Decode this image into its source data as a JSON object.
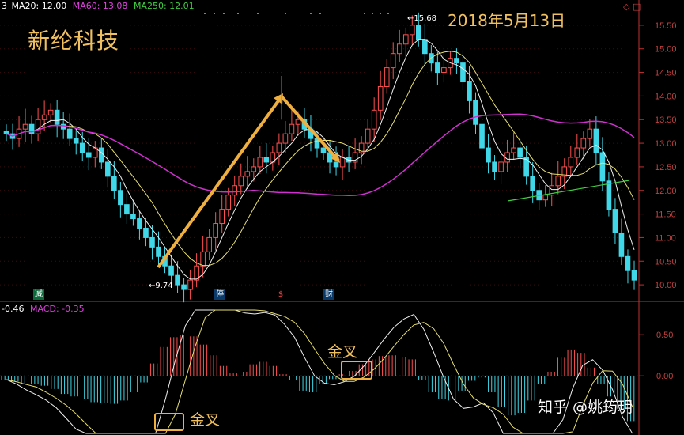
{
  "header": {
    "items": [
      {
        "text": "3",
        "color": "#ffffff"
      },
      {
        "text": "MA20: 12.00",
        "color": "#ffffff"
      },
      {
        "text": "MA60: 13.08",
        "color": "#e040e0"
      },
      {
        "text": "MA250: 12.01",
        "color": "#40d040"
      }
    ],
    "macd_items": [
      {
        "text": "-0.46",
        "color": "#ffffff"
      },
      {
        "text": "MACD: -0.35",
        "color": "#e040e0"
      }
    ]
  },
  "stock_name": "新纶科技",
  "date_label": "2018年5月13日",
  "annotations": {
    "low_label": "9.74",
    "high_label": "15.68",
    "golden_cross_1": "金叉",
    "golden_cross_2": "金叉"
  },
  "event_markers": [
    {
      "text": "减",
      "bg": "#0a6a3a",
      "color": "#ffffff"
    },
    {
      "text": "停",
      "bg": "#0a3a6a",
      "color": "#ffffff"
    },
    {
      "text": "$",
      "bg": "#000000",
      "color": "#ff4040"
    },
    {
      "text": "财",
      "bg": "#0a3a6a",
      "color": "#ffffff"
    }
  ],
  "watermark": "知乎 @姚筠玥",
  "colors": {
    "up": "#ff5050",
    "down": "#40d8e8",
    "ma_white": "#f0f0f0",
    "ma_yellow": "#e8e070",
    "ma_magenta": "#d030d0",
    "ma_green": "#40d040",
    "arrow": "#f0b040",
    "axis": "#c03030",
    "axis_text": "#c04040",
    "label_orange": "#f0c060"
  },
  "chart_data": [
    {
      "type": "candlestick",
      "title": "新纶科技",
      "ylim": [
        9.7,
        15.8
      ],
      "y_ticks": [
        "10.00",
        "10.50",
        "11.00",
        "11.50",
        "12.00",
        "12.50",
        "13.00",
        "13.50",
        "14.00",
        "14.50",
        "15.00",
        "15.50"
      ],
      "close": [
        13.2,
        13.1,
        13.3,
        13.4,
        13.2,
        13.5,
        13.6,
        13.7,
        13.4,
        13.3,
        13.1,
        13.0,
        12.8,
        12.7,
        12.9,
        12.6,
        12.3,
        12.0,
        11.7,
        11.5,
        11.4,
        11.2,
        11.0,
        10.8,
        10.6,
        10.4,
        10.2,
        10.0,
        9.9,
        10.1,
        10.4,
        10.7,
        11.0,
        11.3,
        11.6,
        11.9,
        12.1,
        12.3,
        12.4,
        12.5,
        12.7,
        12.6,
        12.8,
        13.0,
        13.2,
        13.4,
        13.5,
        13.3,
        13.1,
        12.9,
        12.8,
        12.6,
        12.5,
        12.7,
        12.6,
        12.8,
        13.0,
        13.3,
        13.7,
        14.2,
        14.6,
        14.9,
        15.1,
        15.3,
        15.5,
        15.2,
        14.9,
        14.7,
        14.5,
        14.6,
        14.8,
        14.7,
        14.3,
        13.9,
        13.4,
        12.9,
        12.6,
        12.4,
        12.6,
        12.8,
        12.9,
        12.7,
        12.3,
        12.0,
        11.8,
        11.9,
        12.1,
        12.3,
        12.5,
        12.7,
        12.9,
        13.1,
        13.3,
        12.8,
        12.2,
        11.6,
        11.1,
        10.6,
        10.3,
        10.1
      ],
      "macd_histogram": [
        -0.05,
        -0.07,
        -0.1,
        -0.1,
        -0.12,
        -0.16,
        -0.22,
        -0.25,
        -0.28,
        -0.32,
        -0.33,
        -0.34,
        -0.3,
        -0.2,
        -0.08,
        0.15,
        0.35,
        0.47,
        0.5,
        0.48,
        0.38,
        0.25,
        0.12,
        0.03,
        0.05,
        0.14,
        0.17,
        0.12,
        0.02,
        -0.05,
        -0.18,
        -0.2,
        -0.1,
        -0.04,
        0.02,
        0.06,
        0.14,
        0.2,
        0.24,
        0.25,
        0.23,
        0.2,
        -0.05,
        -0.2,
        -0.28,
        -0.3,
        -0.18,
        -0.06,
        -0.02,
        -0.2,
        -0.38,
        -0.48,
        -0.45,
        -0.3,
        -0.1,
        0.05,
        0.22,
        0.32,
        0.28,
        0.1,
        -0.1,
        -0.25,
        -0.4,
        -0.55
      ],
      "macd_ylim": [
        -0.7,
        0.8
      ],
      "macd_y_ticks": [
        "0.50",
        "0.00"
      ],
      "legend": [
        {
          "name": "MA20",
          "value": "12.00"
        },
        {
          "name": "MA60",
          "value": "13.08"
        },
        {
          "name": "MA250",
          "value": "12.01"
        }
      ],
      "macd_legend": "MACD: -0.35"
    }
  ]
}
